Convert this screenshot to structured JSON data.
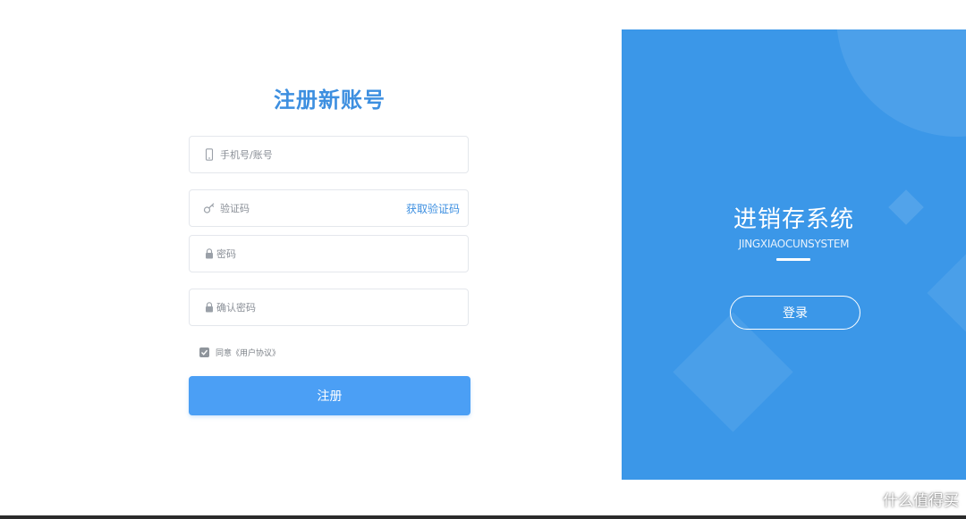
{
  "register": {
    "title": "注册新账号",
    "phone_placeholder": "手机号/账号",
    "code_placeholder": "验证码",
    "get_code_label": "获取验证码",
    "password_placeholder": "密码",
    "confirm_placeholder": "确认密码",
    "agree_text": "同意《用户协议》",
    "agree_checked": true,
    "submit_label": "注册"
  },
  "panel": {
    "title": "进销存系统",
    "subtitle": "JINGXIAOCUNSYSTEM",
    "login_label": "登录"
  },
  "watermark": {
    "text": "什么值得买"
  },
  "colors": {
    "accent": "#3d8fe0",
    "button": "#4b9ff5",
    "panel": "#3b97e8"
  }
}
